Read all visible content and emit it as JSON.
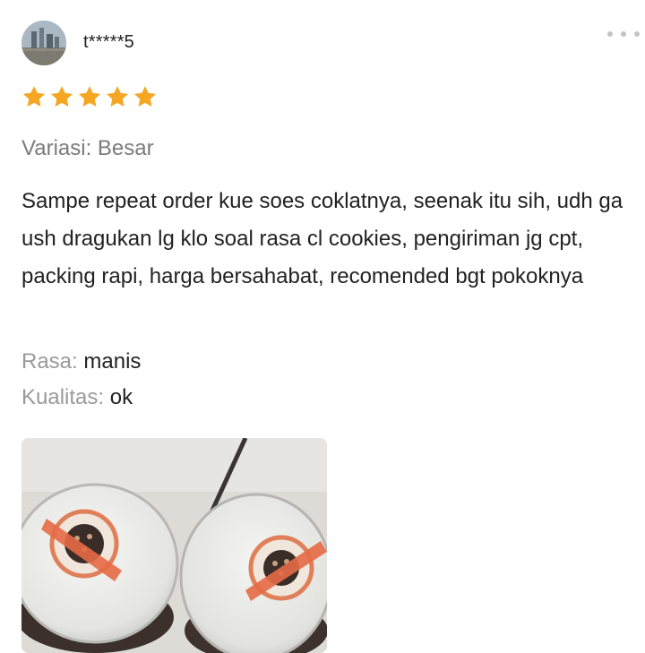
{
  "review": {
    "username": "t*****5",
    "rating": 5,
    "rating_max": 5,
    "variant": "Variasi: Besar",
    "text": "Sampe repeat order kue soes coklatnya, seenak itu sih, udh ga ush dragukan lg klo soal rasa cl cookies, pengiriman jg cpt, packing rapi, harga bersahabat, recomended bgt pokoknya",
    "attributes": [
      {
        "label": "Rasa:",
        "value": "manis"
      },
      {
        "label": "Kualitas:",
        "value": "ok"
      }
    ]
  },
  "icons": {
    "star": "star-icon",
    "more": "more-icon"
  },
  "colors": {
    "star": "#f5a623",
    "label_gray": "#9a9a9a",
    "text": "#222222"
  }
}
